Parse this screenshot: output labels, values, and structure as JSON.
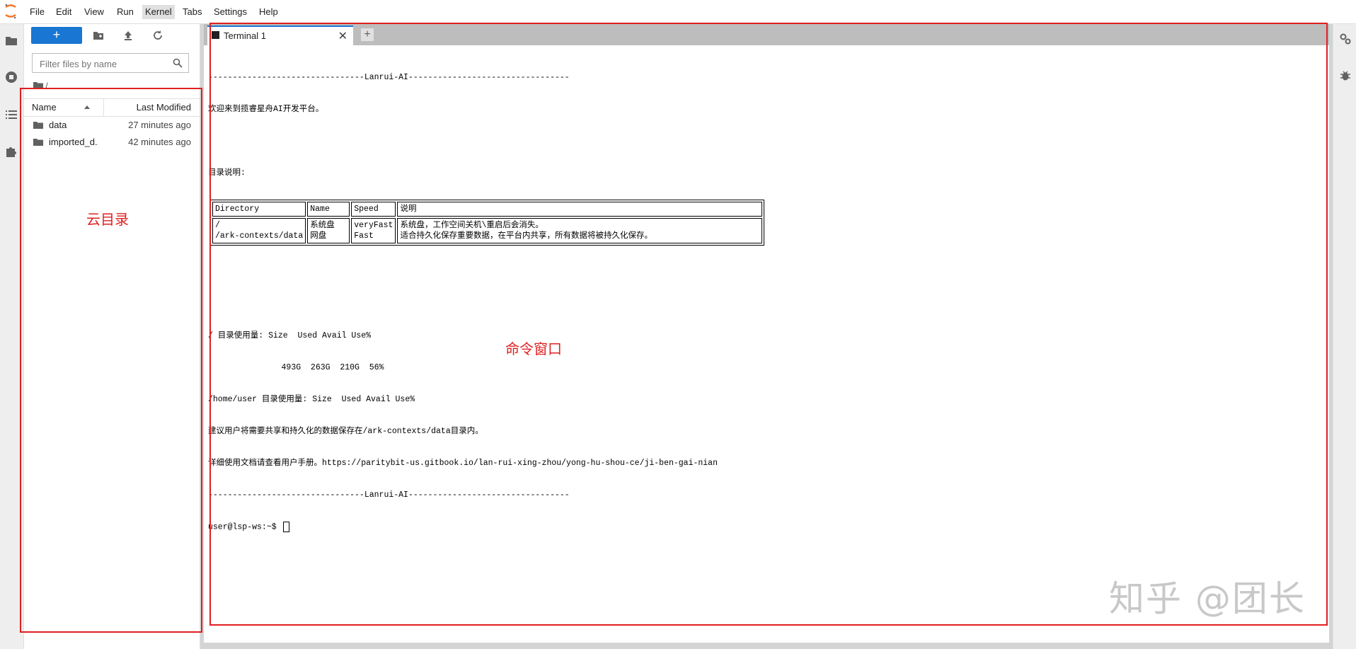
{
  "menubar": {
    "items": [
      "File",
      "Edit",
      "View",
      "Run",
      "Kernel",
      "Tabs",
      "Settings",
      "Help"
    ],
    "active": "Kernel"
  },
  "filebrowser": {
    "new_label": "+",
    "filter_placeholder": "Filter files by name",
    "breadcrumb": "/",
    "col_name": "Name",
    "col_modified": "Last Modified",
    "files": [
      {
        "name": "data",
        "modified": "27 minutes ago"
      },
      {
        "name": "imported_d...",
        "modified": "42 minutes ago"
      }
    ]
  },
  "tabs": [
    {
      "title": "Terminal 1",
      "close": "✕"
    }
  ],
  "tab_add": "+",
  "terminal": {
    "banner_top": "--------------------------------Lanrui-AI---------------------------------",
    "welcome": "欢迎来到揽睿星舟AI开发平台。",
    "dir_heading": "目录说明:",
    "table": {
      "headers": [
        "Directory",
        "Name",
        "Speed",
        "说明"
      ],
      "row": {
        "dirs": [
          "/",
          "/ark-contexts/data"
        ],
        "names": [
          "系统盘",
          "网盘"
        ],
        "speeds": [
          "veryFast",
          "Fast"
        ],
        "notes": [
          "系统盘，工作空间关机\\重启后会消失。",
          "适合持久化保存重要数据，在平台内共享，所有数据将被持久化保存。"
        ]
      }
    },
    "usage_root": "/ 目录使用量: Size  Used Avail Use%",
    "usage_root_vals": "               493G  263G  210G  56%",
    "usage_home": "/home/user 目录使用量: Size  Used Avail Use%",
    "advice": "建议用户将需要共享和持久化的数据保存在/ark-contexts/data目录内。",
    "manual": "详细使用文档请查看用户手册。https://paritybit-us.gitbook.io/lan-rui-xing-zhou/yong-hu-shou-ce/ji-ben-gai-nian",
    "banner_bottom": "--------------------------------Lanrui-AI---------------------------------",
    "prompt": "user@lsp-ws:~$ "
  },
  "annotations": {
    "cloud_dir": "云目录",
    "cmd_window": "命令窗口"
  },
  "watermark": "知乎 @团长",
  "colors": {
    "accent": "#1976d2",
    "annotation_red": "#e02020"
  }
}
